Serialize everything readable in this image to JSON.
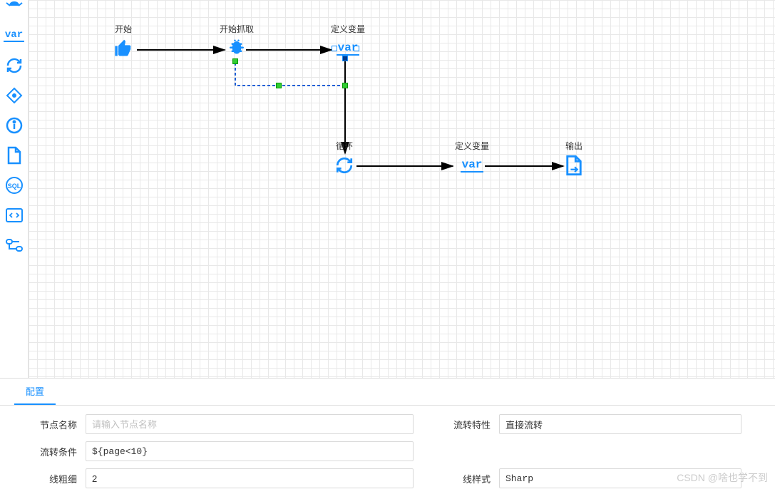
{
  "toolbar": {
    "items": [
      {
        "name": "bug-icon"
      },
      {
        "name": "var-icon",
        "text": "var"
      },
      {
        "name": "loop-icon"
      },
      {
        "name": "diamond-icon"
      },
      {
        "name": "info-icon"
      },
      {
        "name": "page-icon"
      },
      {
        "name": "sql-icon"
      },
      {
        "name": "code-icon"
      },
      {
        "name": "flow-icon"
      }
    ]
  },
  "canvas": {
    "nodes": {
      "start": {
        "label": "开始"
      },
      "crawl": {
        "label": "开始抓取"
      },
      "def1": {
        "label": "定义变量",
        "icon_text": "var"
      },
      "loop": {
        "label": "循环"
      },
      "def2": {
        "label": "定义变量",
        "icon_text": "var"
      },
      "output": {
        "label": "输出"
      }
    }
  },
  "panel": {
    "tab": "配置",
    "fields": {
      "node_name": {
        "label": "节点名称",
        "placeholder": "请输入节点名称",
        "value": ""
      },
      "flow_trait": {
        "label": "流转特性",
        "value": "直接流转"
      },
      "flow_cond": {
        "label": "流转条件",
        "value": "${page<10}"
      },
      "line_weight": {
        "label": "线粗细",
        "value": "2"
      },
      "line_style": {
        "label": "线样式",
        "value": "Sharp"
      }
    }
  },
  "watermark": "CSDN @啥也学不到"
}
